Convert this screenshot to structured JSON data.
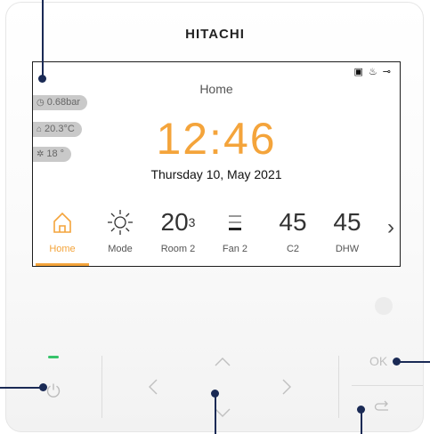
{
  "brand": "HITACHI",
  "screen": {
    "title": "Home",
    "status_icons": [
      "heater-icon",
      "circuit-icon",
      "wrench-icon"
    ],
    "pills": [
      {
        "icon": "pressure-icon",
        "text": "0.68bar"
      },
      {
        "icon": "house-temp-icon",
        "text": "20.3°C"
      },
      {
        "icon": "outdoor-temp-icon",
        "text": "18 °"
      }
    ],
    "clock": "12:46",
    "date": "Thursday 10, May 2021",
    "nav": [
      {
        "label": "Home",
        "value": "",
        "icon": "home-icon",
        "active": true
      },
      {
        "label": "Mode",
        "value": "",
        "icon": "sun-icon",
        "active": false
      },
      {
        "label": "Room 2",
        "value": "20",
        "value_small": "3",
        "active": false
      },
      {
        "label": "Fan 2",
        "value": "",
        "icon": "fan-bars-icon",
        "active": false
      },
      {
        "label": "C2",
        "value": "45",
        "active": false
      },
      {
        "label": "DHW",
        "value": "45",
        "active": false
      }
    ]
  },
  "buttons": {
    "ok_label": "OK"
  },
  "colors": {
    "accent": "#f4a43b",
    "callout": "#1a2a55",
    "led": "#36c36a"
  }
}
